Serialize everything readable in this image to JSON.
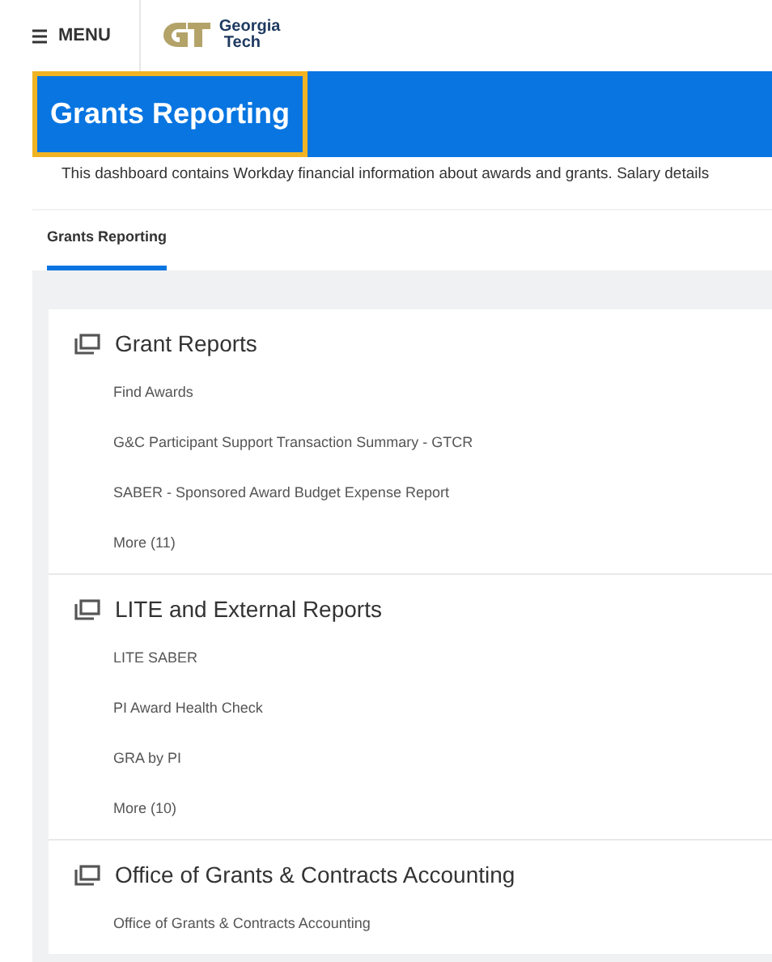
{
  "header": {
    "menu_label": "MENU",
    "logo_text": [
      "Georgia",
      "Tech"
    ]
  },
  "title": "Grants Reporting",
  "description": "This dashboard contains Workday financial information about awards and grants. Salary details",
  "tabs": [
    {
      "label": "Grants Reporting",
      "selected": true
    }
  ],
  "sections": [
    {
      "title": "Grant Reports",
      "links": [
        "Find Awards",
        "G&C Participant Support Transaction Summary - GTCR",
        "SABER - Sponsored Award Budget Expense Report",
        "More (11)"
      ]
    },
    {
      "title": "LITE and External Reports",
      "links": [
        "LITE SABER",
        "PI Award Health Check",
        "GRA by PI",
        "More (10)"
      ]
    },
    {
      "title": "Office of Grants & Contracts Accounting",
      "links": [
        "Office of Grants & Contracts Accounting"
      ]
    }
  ]
}
